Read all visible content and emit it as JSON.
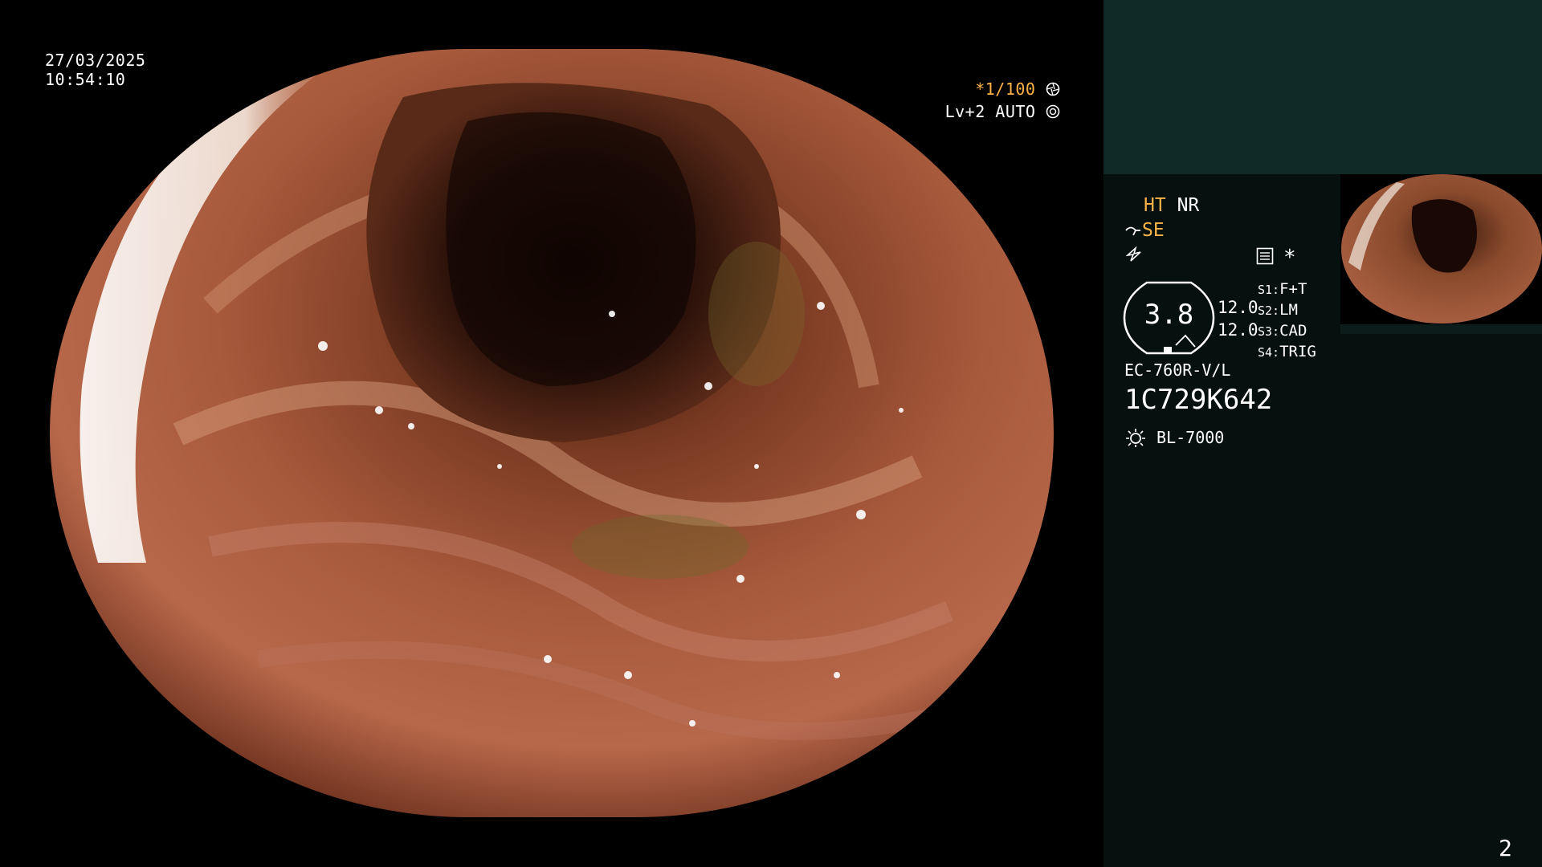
{
  "osd": {
    "date": "27/03/2025",
    "time": "10:54:10",
    "shutter": "*1/100",
    "level": "Lv+2 AUTO"
  },
  "panel": {
    "ht": "HT",
    "nr": "NR",
    "se": "SE",
    "gauge_value": "3.8",
    "val_top": "12.0",
    "val_bottom": "12.0",
    "switches": [
      {
        "key": "S1:",
        "value": "F+T"
      },
      {
        "key": "S2:",
        "value": "LM"
      },
      {
        "key": "S3:",
        "value": "CAD"
      },
      {
        "key": "S4:",
        "value": "TRIG"
      }
    ],
    "scope_model": "EC-760R-V/L",
    "serial": "1C729K642",
    "light_source": "BL-7000",
    "asterisk": "*",
    "page_number": "2"
  },
  "icons": {
    "shutter": "aperture-icon",
    "level": "iris-icon",
    "se": "scope-tip-icon",
    "freeze": "lightning-icon",
    "menu": "settings-panel-icon",
    "light": "sun-lamp-icon"
  },
  "colors": {
    "panel_background": "#06100f",
    "panel_header": "#0f2926",
    "accent_orange": "#ffb347"
  }
}
